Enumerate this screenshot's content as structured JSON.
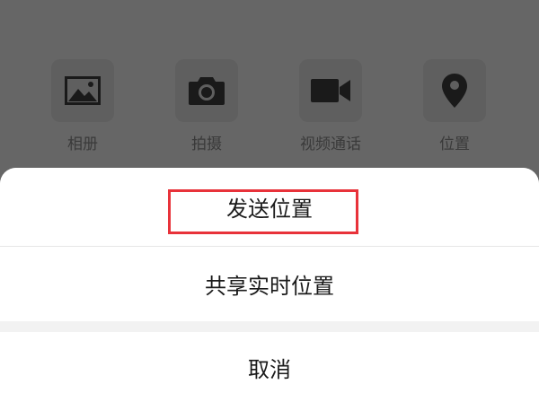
{
  "actions": [
    {
      "label": "相册",
      "icon": "photo-album-icon"
    },
    {
      "label": "拍摄",
      "icon": "camera-icon"
    },
    {
      "label": "视频通话",
      "icon": "video-call-icon"
    },
    {
      "label": "位置",
      "icon": "location-pin-icon"
    }
  ],
  "sheet": {
    "send_location": "发送位置",
    "share_realtime_location": "共享实时位置",
    "cancel": "取消"
  },
  "colors": {
    "overlay": "#666666",
    "highlight": "#e8323a",
    "sheet_bg": "#ffffff"
  }
}
